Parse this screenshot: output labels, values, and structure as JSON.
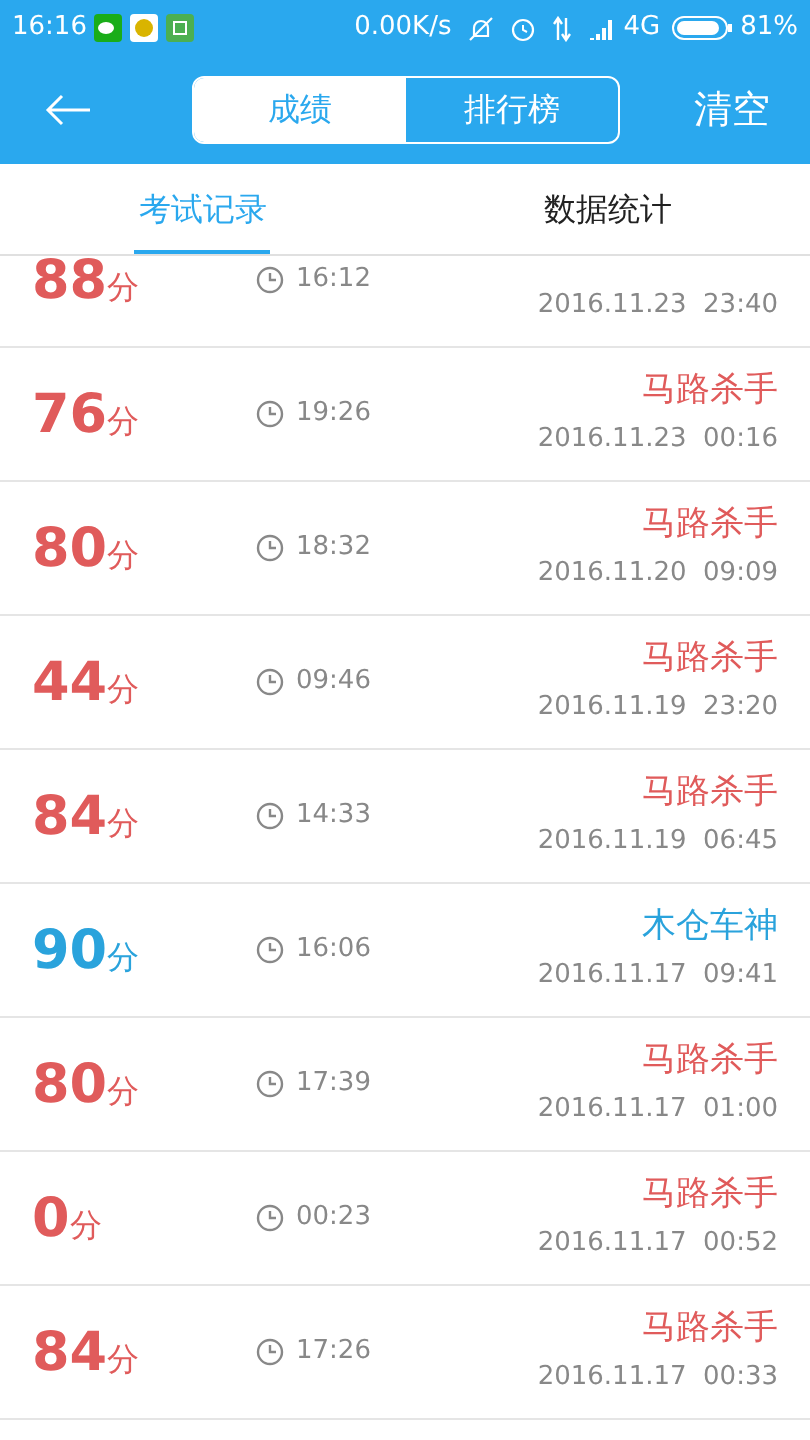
{
  "status_bar": {
    "time": "16:16",
    "speed": "0.00K/s",
    "network": "4G",
    "battery": "81%"
  },
  "header": {
    "segments": [
      {
        "label": "成绩",
        "selected": true
      },
      {
        "label": "排行榜",
        "selected": false
      }
    ],
    "action": "清空"
  },
  "tabs": [
    {
      "label": "考试记录",
      "selected": true
    },
    {
      "label": "数据统计",
      "selected": false
    }
  ],
  "records": [
    {
      "score": "88",
      "unit": "分",
      "duration": "16:12",
      "date": "2016.11.23  23:40",
      "color": "#e05b5b"
    },
    {
      "score": "76",
      "unit": "分",
      "duration": "19:26",
      "name": "马路杀手",
      "date": "2016.11.23  00:16",
      "color": "#e05b5b"
    },
    {
      "score": "80",
      "unit": "分",
      "duration": "18:32",
      "name": "马路杀手",
      "date": "2016.11.20  09:09",
      "color": "#e05b5b"
    },
    {
      "score": "44",
      "unit": "分",
      "duration": "09:46",
      "name": "马路杀手",
      "date": "2016.11.19  23:20",
      "color": "#e05b5b"
    },
    {
      "score": "84",
      "unit": "分",
      "duration": "14:33",
      "name": "马路杀手",
      "date": "2016.11.19  06:45",
      "color": "#e05b5b"
    },
    {
      "score": "90",
      "unit": "分",
      "duration": "16:06",
      "name": "木仓车神",
      "date": "2016.11.17  09:41",
      "color": "#2aa3dc"
    },
    {
      "score": "80",
      "unit": "分",
      "duration": "17:39",
      "name": "马路杀手",
      "date": "2016.11.17  01:00",
      "color": "#e05b5b"
    },
    {
      "score": "0",
      "unit": "分",
      "duration": "00:23",
      "name": "马路杀手",
      "date": "2016.11.17  00:52",
      "color": "#e05b5b"
    },
    {
      "score": "84",
      "unit": "分",
      "duration": "17:26",
      "name": "马路杀手",
      "date": "2016.11.17  00:33",
      "color": "#e05b5b"
    }
  ]
}
